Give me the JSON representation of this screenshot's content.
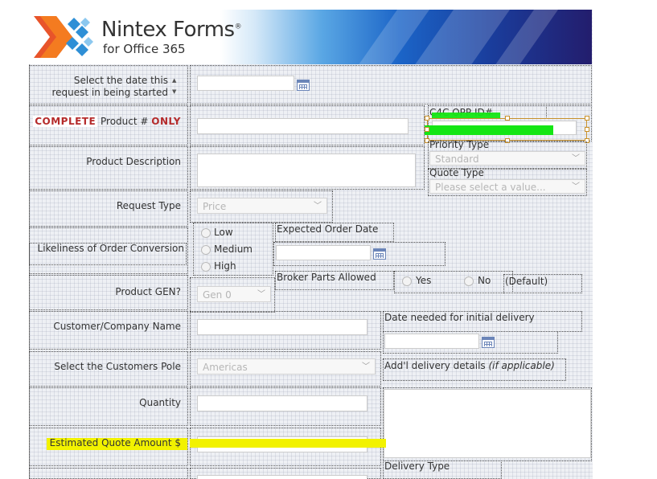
{
  "brand": {
    "title": "Nintex Forms",
    "trademark": "®",
    "subtitle": "for Office 365"
  },
  "fields": {
    "request_date_label": "Select the date this request in being started",
    "product_number": {
      "prefix": "COMPLETE",
      "middle": "Product #",
      "suffix": "ONLY"
    },
    "product_description_label": "Product Description",
    "request_type_label": "Request Type",
    "request_type_value": "Price",
    "likeliness_label": "Likeliness of Order Conversion",
    "likeliness_options": [
      "Low",
      "Medium",
      "High"
    ],
    "expected_order_date_label": "Expected Order Date",
    "broker_parts_label": "Broker Parts Allowed",
    "broker_options": [
      "Yes",
      "No"
    ],
    "broker_default_note": "(Default)",
    "product_gen_label": "Product GEN?",
    "product_gen_value": "Gen 0",
    "customer_label": "Customer/Company Name",
    "date_needed_label": "Date needed for initial delivery",
    "customers_pole_label": "Select the Customers Pole",
    "customers_pole_value": "Americas",
    "addl_delivery_label": "Add'l delivery details",
    "addl_delivery_note": "(if applicable)",
    "quantity_label": "Quantity",
    "estimated_quote_label": "Estimated Quote Amount $",
    "delivery_type_label": "Delivery Type",
    "c4c_label": "C4C OPP ID#",
    "priority_type_label": "Priority Type",
    "priority_type_value": "Standard",
    "quote_type_label": "Quote Type",
    "quote_type_placeholder": "Please select a value..."
  },
  "colors": {
    "highlight_green": "#14e614",
    "highlight_yellow": "#f2f200",
    "required_red": "#b52b2b"
  }
}
